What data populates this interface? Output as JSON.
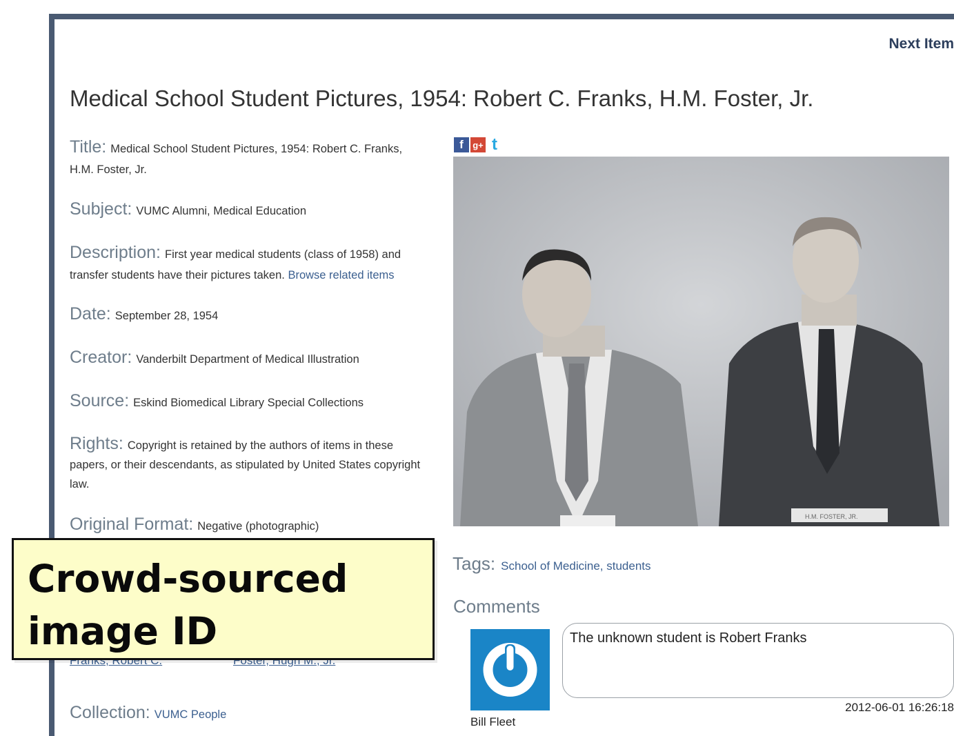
{
  "nav": {
    "next_label": "Next Item"
  },
  "page_title": "Medical School Student Pictures, 1954: Robert C. Franks, H.M. Foster, Jr.",
  "metadata": {
    "title_label": "Title:",
    "title_value": "Medical School Student Pictures, 1954: Robert C. Franks, H.M. Foster, Jr.",
    "subject_label": "Subject:",
    "subject_value": "VUMC Alumni, Medical Education",
    "description_label": "Description:",
    "description_value": "First year medical students (class of 1958) and transfer students have their pictures taken.",
    "browse_related": "Browse related items",
    "date_label": "Date:",
    "date_value": "September 28, 1954",
    "creator_label": "Creator:",
    "creator_value": "Vanderbilt Department of Medical Illustration",
    "source_label": "Source:",
    "source_value": "Eskind Biomedical Library Special Collections",
    "rights_label": "Rights:",
    "rights_value": "Copyright is retained by the authors of items in these papers, or their descendants, as stipulated by United States copyright law.",
    "format_label": "Original Format:",
    "format_value": "Negative (photographic)",
    "collection_label": "Collection:",
    "collection_value": "VUMC People"
  },
  "people_partial": [
    "Franks, Robert C.",
    "Foster, Hugh M., Jr."
  ],
  "social": {
    "facebook": "f",
    "google_plus": "g+",
    "twitter": "t"
  },
  "photo": {
    "placard": "H.M. FOSTER, JR."
  },
  "tags": {
    "label": "Tags:",
    "items": [
      "School of Medicine",
      "students"
    ],
    "separator": ", "
  },
  "comments": {
    "heading": "Comments",
    "items": [
      {
        "author": "Bill Fleet",
        "text": "The unknown student is Robert Franks",
        "timestamp": "2012-06-01 16:26:18"
      }
    ]
  },
  "callout": {
    "text": "Crowd-sourced\nimage ID"
  },
  "colors": {
    "frame": "#4a5a72",
    "label": "#6e7d8b",
    "link": "#3b5f8f",
    "callout_bg": "#fdfdc9",
    "avatar_bg": "#1a85c7"
  }
}
